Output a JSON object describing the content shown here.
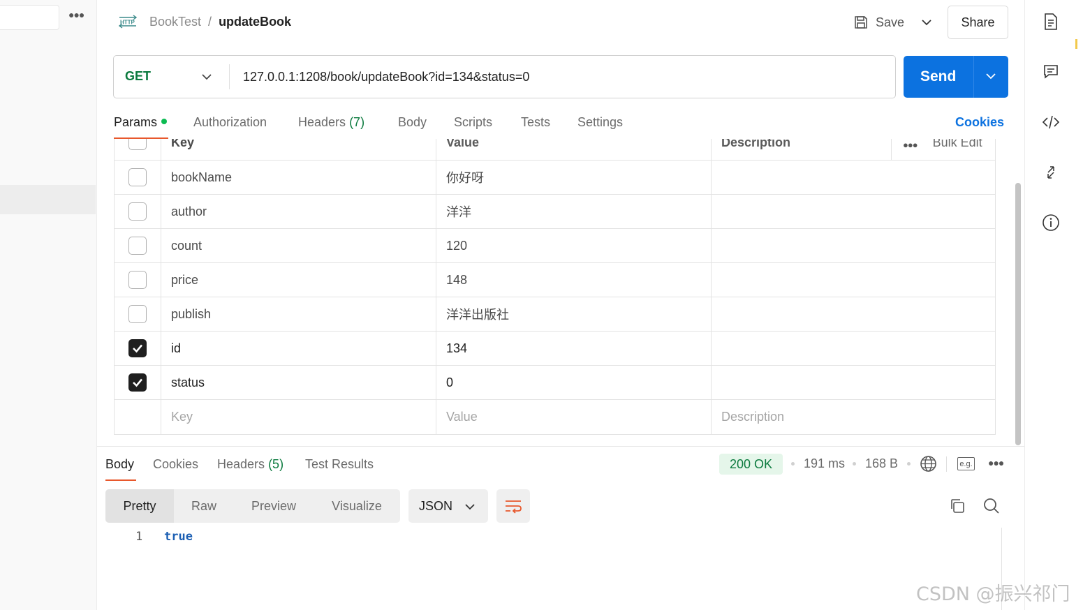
{
  "sidebar": {
    "more_icon": "more-horizontal-icon"
  },
  "header": {
    "http_icon": "http-icon",
    "breadcrumb_parent": "BookTest",
    "breadcrumb_sep": "/",
    "breadcrumb_current": "updateBook",
    "save_label": "Save",
    "share_label": "Share"
  },
  "request": {
    "method": "GET",
    "url": "127.0.0.1:1208/book/updateBook?id=134&status=0",
    "send_label": "Send"
  },
  "request_tabs": [
    {
      "label": "Params",
      "count": ""
    },
    {
      "label": "Authorization",
      "count": ""
    },
    {
      "label": "Headers",
      "count": "(7)"
    },
    {
      "label": "Body",
      "count": ""
    },
    {
      "label": "Scripts",
      "count": ""
    },
    {
      "label": "Tests",
      "count": ""
    },
    {
      "label": "Settings",
      "count": ""
    }
  ],
  "cookies_label": "Cookies",
  "params": {
    "headers": {
      "key": "Key",
      "value": "Value",
      "description": "Description",
      "bulk_edit": "Bulk Edit"
    },
    "rows": [
      {
        "key": "bookName",
        "value": "你好呀",
        "checked": false
      },
      {
        "key": "author",
        "value": "洋洋",
        "checked": false
      },
      {
        "key": "count",
        "value": "120",
        "checked": false
      },
      {
        "key": "price",
        "value": "148",
        "checked": false
      },
      {
        "key": "publish",
        "value": "洋洋出版社",
        "checked": false
      },
      {
        "key": "id",
        "value": "134",
        "checked": true
      },
      {
        "key": "status",
        "value": "0",
        "checked": true
      }
    ],
    "new_row": {
      "key": "Key",
      "value": "Value",
      "description": "Description"
    }
  },
  "response": {
    "tabs": [
      {
        "label": "Body",
        "count": ""
      },
      {
        "label": "Cookies",
        "count": ""
      },
      {
        "label": "Headers",
        "count": "(5)"
      },
      {
        "label": "Test Results",
        "count": ""
      }
    ],
    "status": "200 OK",
    "time": "191 ms",
    "size": "168 B",
    "view_modes": [
      "Pretty",
      "Raw",
      "Preview",
      "Visualize"
    ],
    "format": "JSON",
    "line_number": "1",
    "body_line": "true"
  },
  "watermark": "CSDN @振兴祁门",
  "colors": {
    "send": "#0c72e0",
    "get_method": "#0b7a3e",
    "status_ok_bg": "#e5f6ea",
    "active_tab_underline": "#e8582c"
  }
}
